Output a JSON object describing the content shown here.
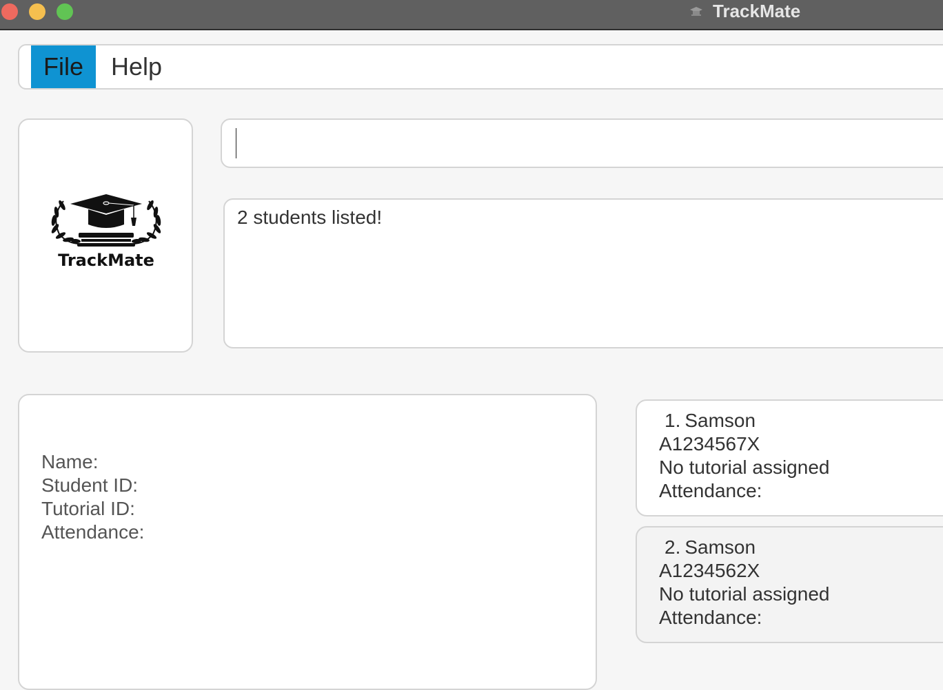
{
  "window": {
    "title": "TrackMate"
  },
  "menu": {
    "file": "File",
    "help": "Help"
  },
  "logo": {
    "text": "TrackMate"
  },
  "command": {
    "value": "",
    "placeholder": ""
  },
  "result": {
    "message": "2 students listed!"
  },
  "detail": {
    "name_label": "Name:",
    "student_id_label": "Student ID:",
    "tutorial_id_label": "Tutorial ID:",
    "attendance_label": "Attendance:"
  },
  "students": [
    {
      "index": "1.",
      "name": "Samson",
      "id": "A1234567X",
      "tutorial": "No tutorial assigned",
      "attendance": "Attendance:"
    },
    {
      "index": "2.",
      "name": "Samson",
      "id": "A1234562X",
      "tutorial": "No tutorial assigned",
      "attendance": "Attendance:"
    }
  ],
  "colors": {
    "accent": "#0f93d2",
    "titlebar": "#606060",
    "close": "#ee6a5f",
    "minimize": "#f5bf4f",
    "maximize": "#61c454"
  }
}
